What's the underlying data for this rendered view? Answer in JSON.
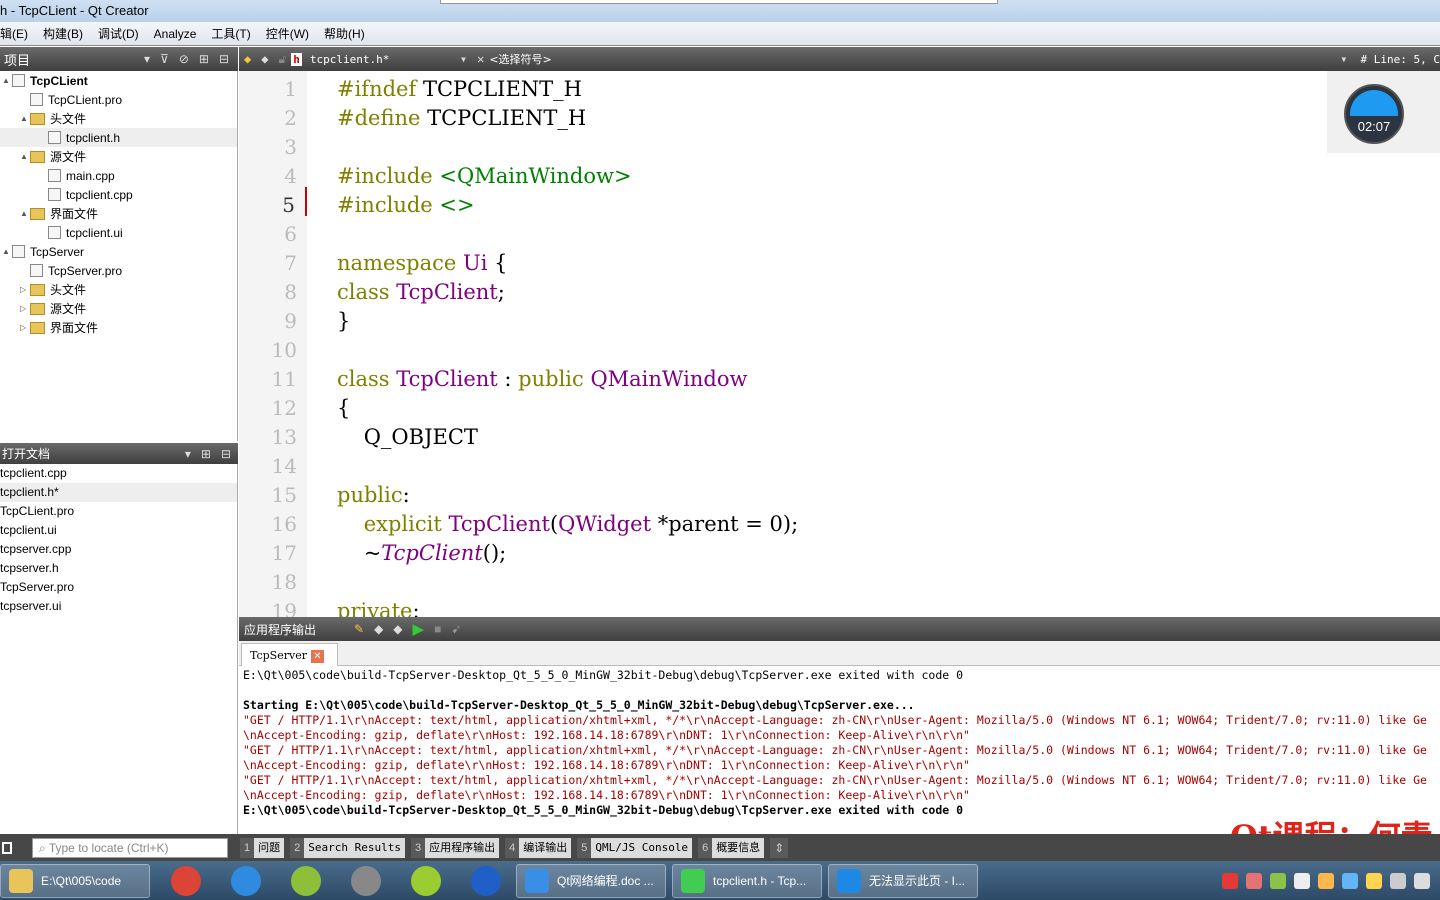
{
  "window": {
    "title": "h - TcpCLient - Qt Creator"
  },
  "menu": [
    "辑(E)",
    "构建(B)",
    "调试(D)",
    "Analyze",
    "工具(T)",
    "控件(W)",
    "帮助(H)"
  ],
  "project_panel": {
    "title": "项目",
    "tree": [
      {
        "label": "TcpCLient",
        "level": 0,
        "kind": "project",
        "bold": true,
        "arrow": "▲"
      },
      {
        "label": "TcpCLient.pro",
        "level": 1,
        "kind": "file"
      },
      {
        "label": "头文件",
        "level": 1,
        "kind": "folder",
        "arrow": "▲"
      },
      {
        "label": "tcpclient.h",
        "level": 2,
        "kind": "file",
        "selected": true
      },
      {
        "label": "源文件",
        "level": 1,
        "kind": "folder",
        "arrow": "▲"
      },
      {
        "label": "main.cpp",
        "level": 2,
        "kind": "file"
      },
      {
        "label": "tcpclient.cpp",
        "level": 2,
        "kind": "file"
      },
      {
        "label": "界面文件",
        "level": 1,
        "kind": "folder",
        "arrow": "▲"
      },
      {
        "label": "tcpclient.ui",
        "level": 2,
        "kind": "file"
      },
      {
        "label": "TcpServer",
        "level": 0,
        "kind": "project",
        "arrow": "▲"
      },
      {
        "label": "TcpServer.pro",
        "level": 1,
        "kind": "file"
      },
      {
        "label": "头文件",
        "level": 1,
        "kind": "folder",
        "arrow": "▷"
      },
      {
        "label": "源文件",
        "level": 1,
        "kind": "folder",
        "arrow": "▷"
      },
      {
        "label": "界面文件",
        "level": 1,
        "kind": "folder",
        "arrow": "▷"
      }
    ]
  },
  "open_docs": {
    "title": "打开文档",
    "items": [
      "tcpclient.cpp",
      "tcpclient.h*",
      "TcpCLient.pro",
      "tcpclient.ui",
      "tcpserver.cpp",
      "tcpserver.h",
      "TcpServer.pro",
      "tcpserver.ui"
    ],
    "selected": 1
  },
  "editor": {
    "file": "tcpclient.h*",
    "symbol": "<选择符号>",
    "position": "# Line: 5, C",
    "current_line": 5,
    "lines": [
      [
        [
          "kw",
          "#ifndef "
        ],
        [
          "pl",
          "TCPCLIENT_H"
        ]
      ],
      [
        [
          "kw",
          "#define "
        ],
        [
          "pl",
          "TCPCLIENT_H"
        ]
      ],
      [],
      [
        [
          "kw",
          "#include "
        ],
        [
          "st",
          "<QMainWindow>"
        ]
      ],
      [
        [
          "kw",
          "#include "
        ],
        [
          "st",
          "<>"
        ]
      ],
      [],
      [
        [
          "kw",
          "namespace "
        ],
        [
          "ty",
          "Ui "
        ],
        [
          "pl",
          "{"
        ]
      ],
      [
        [
          "kw",
          "class "
        ],
        [
          "ty",
          "TcpClient"
        ],
        [
          "pl",
          ";"
        ]
      ],
      [
        [
          "pl",
          "}"
        ]
      ],
      [],
      [
        [
          "kw",
          "class "
        ],
        [
          "ty",
          "TcpClient "
        ],
        [
          "pl",
          ": "
        ],
        [
          "kw",
          "public "
        ],
        [
          "ty",
          "QMainWindow"
        ]
      ],
      [
        [
          "pl",
          "{"
        ]
      ],
      [
        [
          "pl",
          "    Q_OBJECT"
        ]
      ],
      [],
      [
        [
          "kw",
          "public"
        ],
        [
          "pl",
          ":"
        ]
      ],
      [
        [
          "pl",
          "    "
        ],
        [
          "kw",
          "explicit "
        ],
        [
          "ty",
          "TcpClient"
        ],
        [
          "pl",
          "("
        ],
        [
          "ty",
          "QWidget "
        ],
        [
          "pl",
          "*parent = 0);"
        ]
      ],
      [
        [
          "pl",
          "    ~"
        ],
        [
          "it",
          "TcpClient"
        ],
        [
          "pl",
          "();"
        ]
      ],
      [],
      [
        [
          "kw",
          "private"
        ],
        [
          "pl",
          ":"
        ]
      ]
    ]
  },
  "clock": {
    "time": "02:07"
  },
  "output_panel": {
    "title": "应用程序输出",
    "tab": "TcpServer",
    "lines": [
      {
        "t": "E:\\Qt\\005\\code\\build-TcpServer-Desktop_Qt_5_5_0_MinGW_32bit-Debug\\debug\\TcpServer.exe exited with code 0",
        "s": ""
      },
      {
        "t": "",
        "s": ""
      },
      {
        "t": "Starting E:\\Qt\\005\\code\\build-TcpServer-Desktop_Qt_5_5_0_MinGW_32bit-Debug\\debug\\TcpServer.exe...",
        "s": "b"
      },
      {
        "t": "\"GET / HTTP/1.1\\r\\nAccept: text/html, application/xhtml+xml, */*\\r\\nAccept-Language: zh-CN\\r\\nUser-Agent: Mozilla/5.0 (Windows NT 6.1; WOW64; Trident/7.0; rv:11.0) like Ge",
        "s": "r"
      },
      {
        "t": "\\nAccept-Encoding: gzip, deflate\\r\\nHost: 192.168.14.18:6789\\r\\nDNT: 1\\r\\nConnection: Keep-Alive\\r\\n\\r\\n\"",
        "s": "r"
      },
      {
        "t": "\"GET / HTTP/1.1\\r\\nAccept: text/html, application/xhtml+xml, */*\\r\\nAccept-Language: zh-CN\\r\\nUser-Agent: Mozilla/5.0 (Windows NT 6.1; WOW64; Trident/7.0; rv:11.0) like Ge",
        "s": "r"
      },
      {
        "t": "\\nAccept-Encoding: gzip, deflate\\r\\nHost: 192.168.14.18:6789\\r\\nDNT: 1\\r\\nConnection: Keep-Alive\\r\\n\\r\\n\"",
        "s": "r"
      },
      {
        "t": "\"GET / HTTP/1.1\\r\\nAccept: text/html, application/xhtml+xml, */*\\r\\nAccept-Language: zh-CN\\r\\nUser-Agent: Mozilla/5.0 (Windows NT 6.1; WOW64; Trident/7.0; rv:11.0) like Ge",
        "s": "r"
      },
      {
        "t": "\\nAccept-Encoding: gzip, deflate\\r\\nHost: 192.168.14.18:6789\\r\\nDNT: 1\\r\\nConnection: Keep-Alive\\r\\n\\r\\n\"",
        "s": "r"
      },
      {
        "t": "E:\\Qt\\005\\code\\build-TcpServer-Desktop_Qt_5_5_0_MinGW_32bit-Debug\\debug\\TcpServer.exe exited with code 0",
        "s": "b"
      }
    ]
  },
  "watermark": "Qt课程：何青",
  "statusbar": {
    "locate_placeholder": "Type to locate (Ctrl+K)",
    "panes": [
      {
        "n": "1",
        "label": "问题"
      },
      {
        "n": "2",
        "label": "Search Results"
      },
      {
        "n": "3",
        "label": "应用程序输出"
      },
      {
        "n": "4",
        "label": "编译输出"
      },
      {
        "n": "5",
        "label": "QML/JS Console"
      },
      {
        "n": "6",
        "label": "概要信息"
      }
    ]
  },
  "taskbar": {
    "explorer": "E:\\Qt\\005\\code",
    "apps": [
      {
        "name": "chrome",
        "color": "#db4437"
      },
      {
        "name": "browser-cloud",
        "color": "#2e8be0"
      },
      {
        "name": "notepad-plus",
        "color": "#8dbf3a"
      },
      {
        "name": "remote-tool",
        "color": "#888888"
      },
      {
        "name": "tftp",
        "color": "#9acd32"
      },
      {
        "name": "u-app",
        "color": "#1f5fc7"
      }
    ],
    "windows": [
      {
        "label": "Qt网络编程.doc ...",
        "icon": "wps-icon",
        "color": "#3a8ee6"
      },
      {
        "label": "tcpclient.h - Tcp...",
        "icon": "qt-icon",
        "color": "#41cd52"
      },
      {
        "label": "无法显示此页 - I...",
        "icon": "ie-icon",
        "color": "#1e88e5"
      }
    ]
  },
  "colors": {
    "keyword": "#808000",
    "type": "#800080",
    "string": "#008000",
    "accent": "#1e9af0"
  }
}
